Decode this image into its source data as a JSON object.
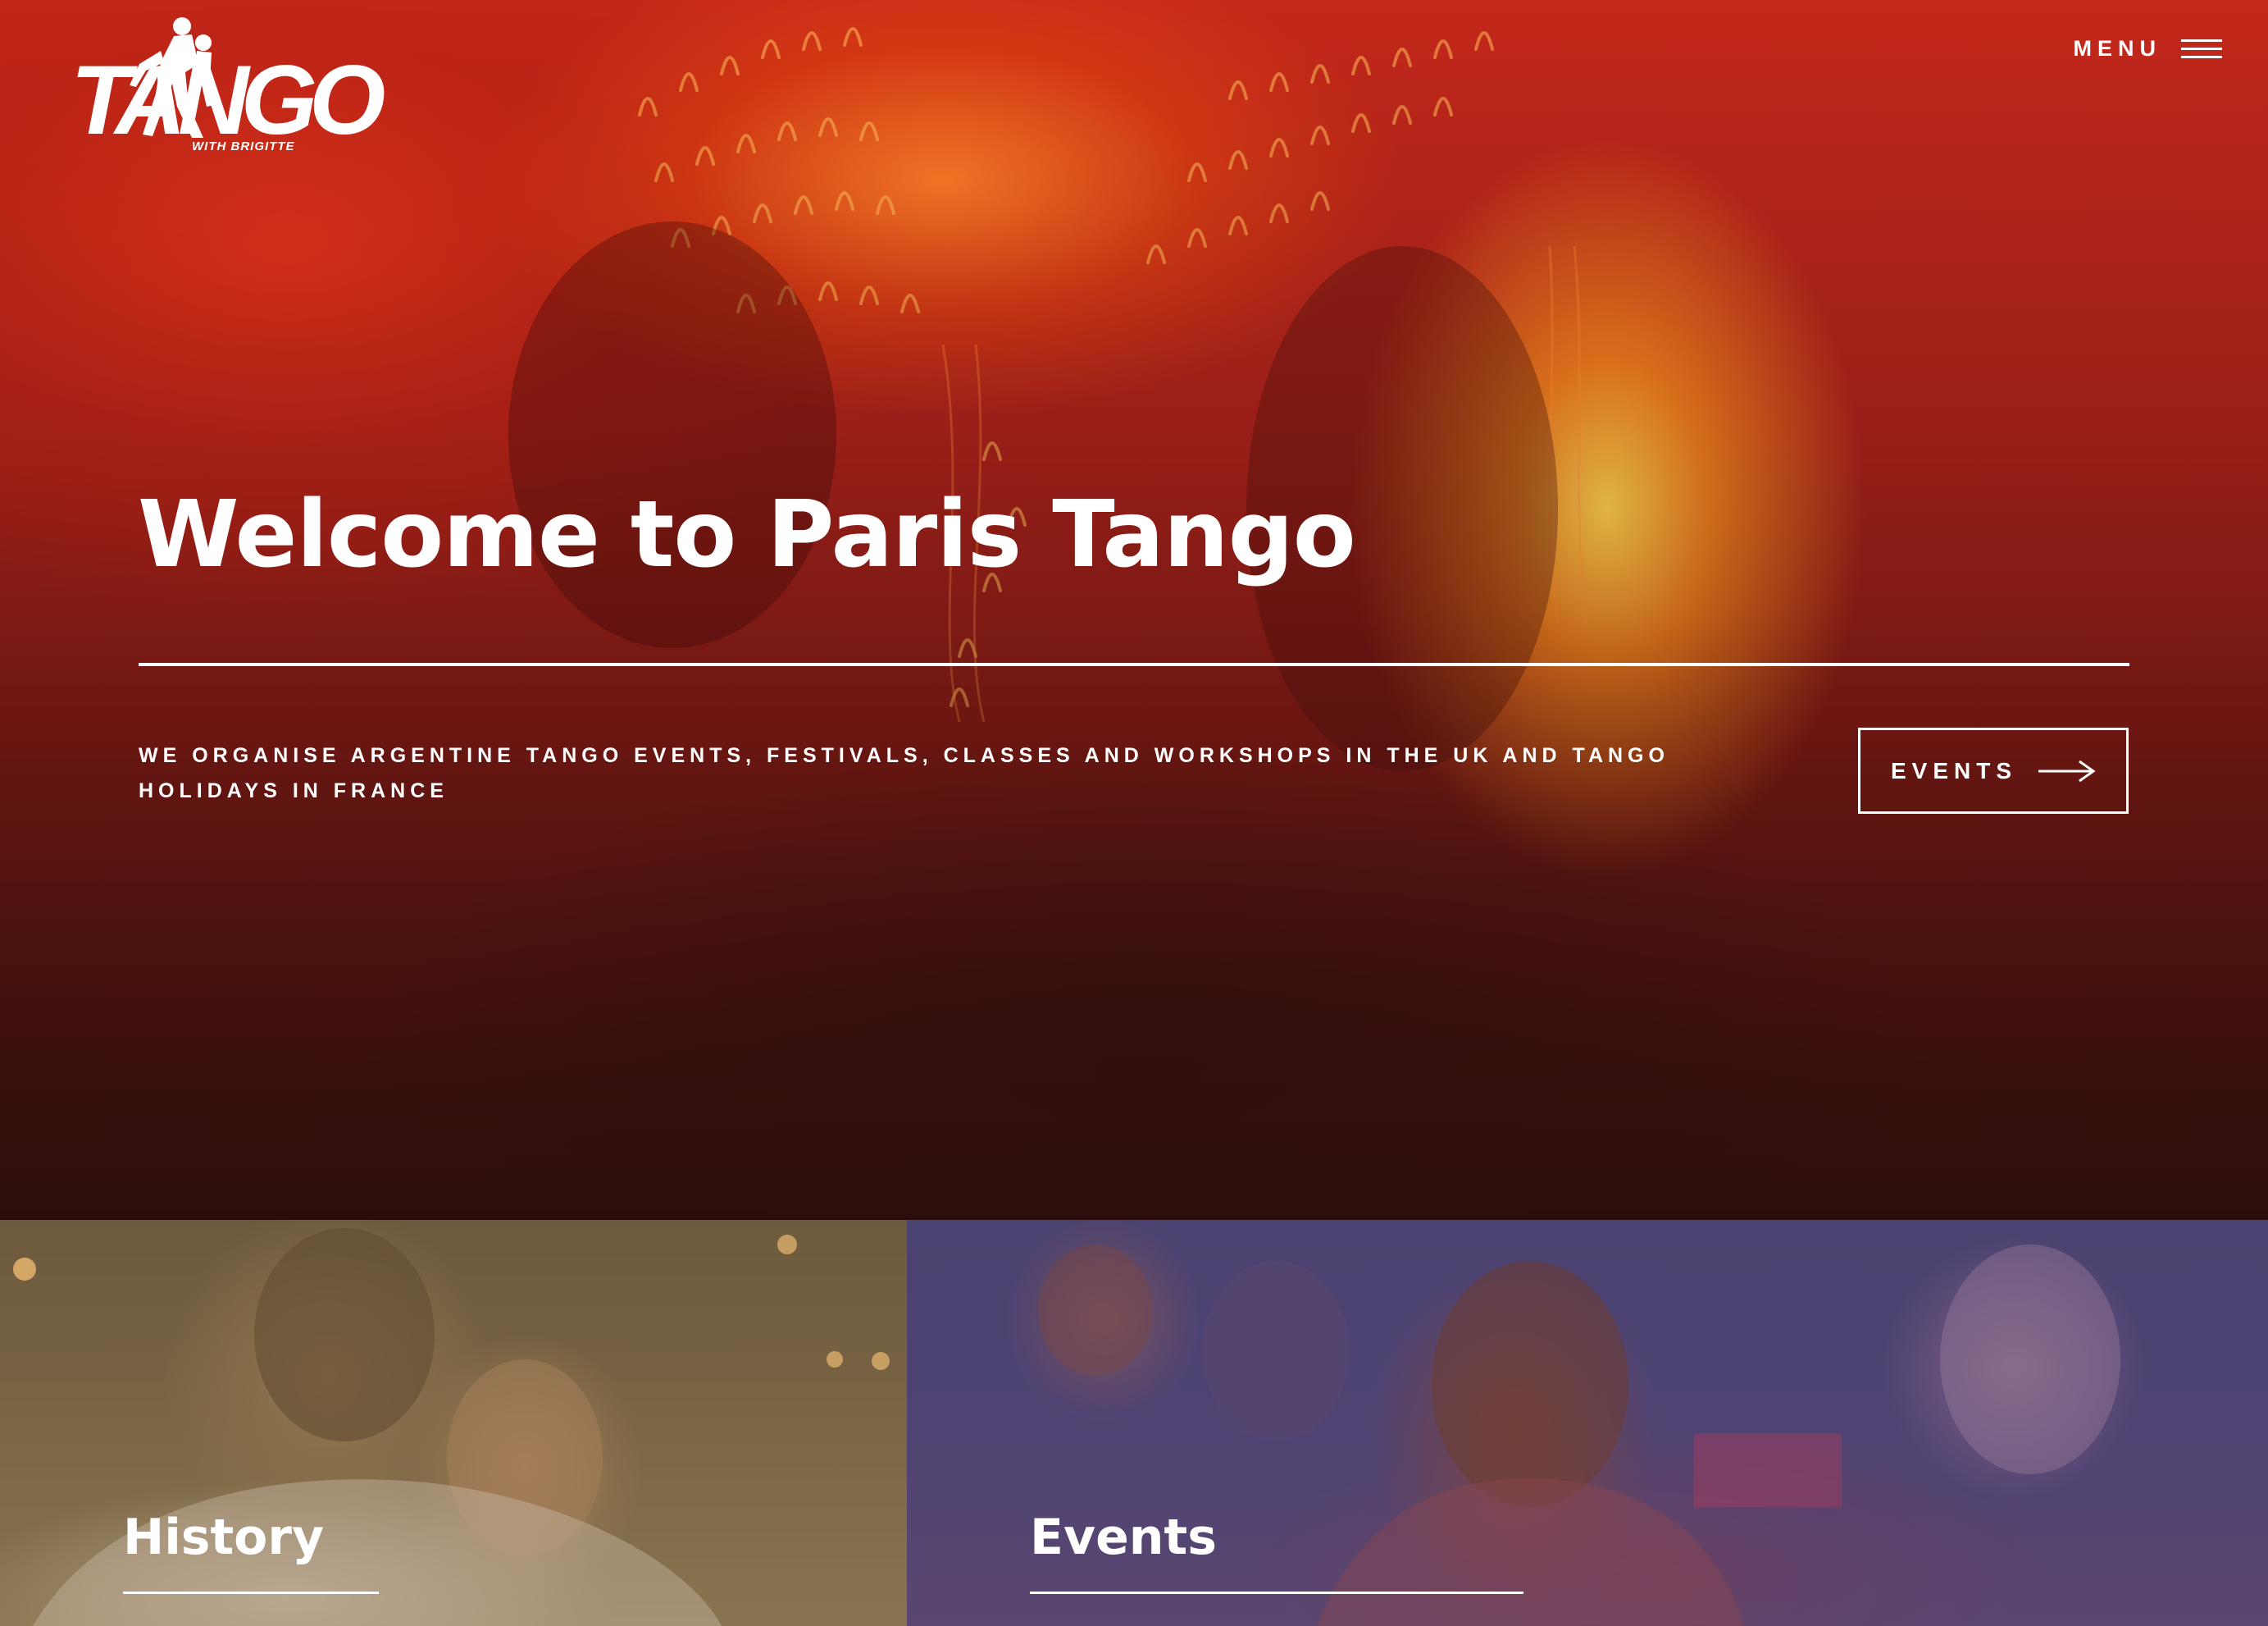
{
  "brand": {
    "logo_text": "TANGO",
    "logo_tagline": "WITH BRIGITTE"
  },
  "nav": {
    "menu_label": "MENU"
  },
  "hero": {
    "title": "Welcome to Paris Tango",
    "tagline": "WE ORGANISE ARGENTINE TANGO EVENTS, FESTIVALS, CLASSES AND WORKSHOPS IN THE UK AND TANGO HOLIDAYS IN FRANCE",
    "cta_label": "EVENTS"
  },
  "cards": [
    {
      "title": "History",
      "tint": "#7a6544"
    },
    {
      "title": "Events",
      "tint": "#4e4373"
    }
  ],
  "colors": {
    "hero_red": "#c4281a",
    "text": "#ffffff"
  },
  "icons": {
    "menu": "hamburger-icon",
    "cta": "arrow-right-icon"
  }
}
